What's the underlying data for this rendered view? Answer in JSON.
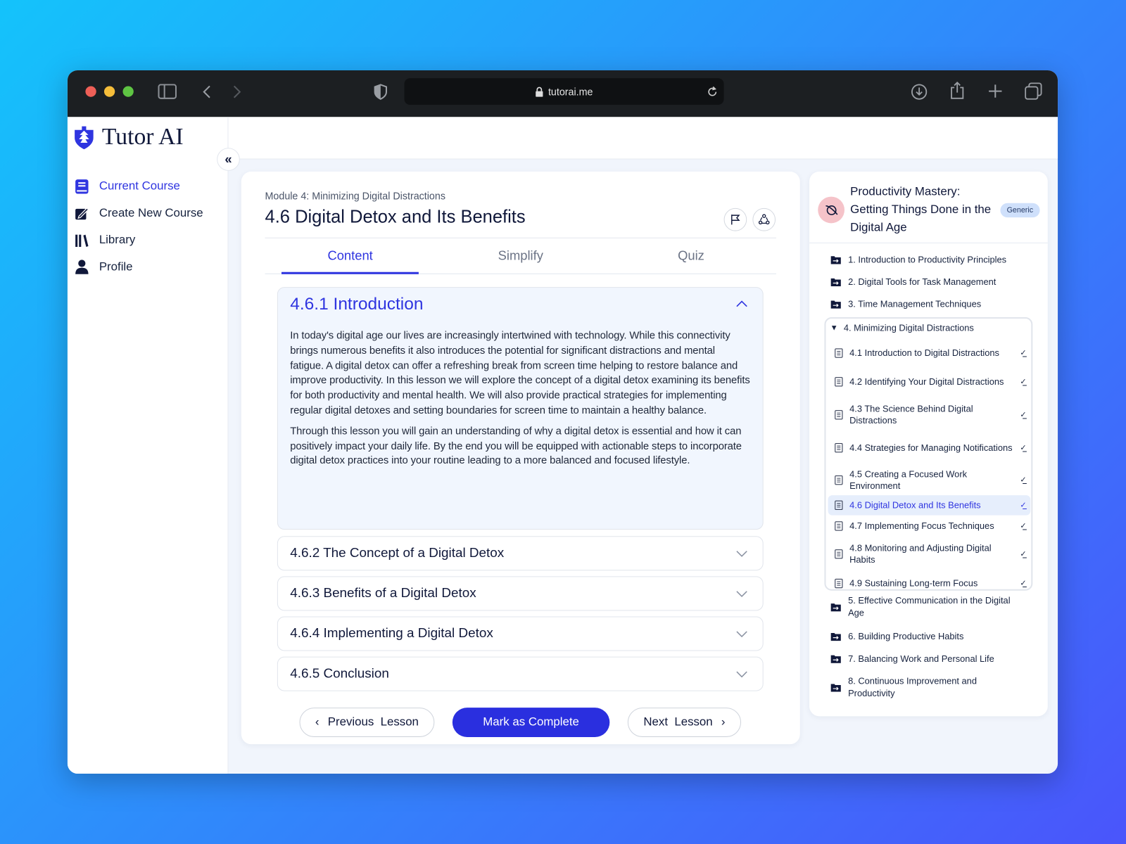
{
  "browser": {
    "url": "tutorai.me"
  },
  "app": {
    "name": "Tutor AI"
  },
  "sidebar": {
    "items": [
      {
        "label": "Current Course",
        "icon": "book-icon",
        "active": true
      },
      {
        "label": "Create New Course",
        "icon": "edit-icon"
      },
      {
        "label": "Library",
        "icon": "library-icon"
      },
      {
        "label": "Profile",
        "icon": "user-icon"
      }
    ]
  },
  "lesson": {
    "module": "Module 4: Minimizing Digital Distractions",
    "title": "4.6 Digital Detox and Its Benefits",
    "tabs": [
      "Content",
      "Simplify",
      "Quiz"
    ],
    "sections": [
      {
        "title": "4.6.1 Introduction",
        "paragraphs": [
          "In today's digital age our lives are increasingly intertwined with technology. While this connectivity brings numerous benefits it also introduces the potential for significant distractions and mental fatigue. A digital detox can offer a refreshing break from screen time helping to restore balance and improve productivity. In this lesson we will explore the concept of a digital detox examining its benefits for both productivity and mental health. We will also provide practical strategies for implementing regular digital detoxes and setting boundaries for screen time to maintain a healthy balance.",
          "Through this lesson you will gain an understanding of why a digital detox is essential and how it can positively impact your daily life. By the end you will be equipped with actionable steps to incorporate digital detox practices into your routine leading to a more balanced and focused lifestyle."
        ]
      },
      {
        "title": "4.6.2 The Concept of a Digital Detox"
      },
      {
        "title": "4.6.3 Benefits of a Digital Detox"
      },
      {
        "title": "4.6.4 Implementing a Digital Detox"
      },
      {
        "title": "4.6.5 Conclusion"
      }
    ],
    "prev_label": "Previous  Lesson",
    "complete_label": "Mark as Complete",
    "next_label": "Next  Lesson"
  },
  "course": {
    "title": "Productivity Mastery: Getting Things Done in the Digital Age",
    "badge": "Generic",
    "modules": [
      "1. Introduction to Productivity Principles",
      "2. Digital Tools for Task Management",
      "3. Time Management Techniques",
      "4. Minimizing Digital Distractions",
      "5. Effective Communication in the Digital Age",
      "6. Building Productive Habits",
      "7. Balancing Work and Personal Life",
      "8. Continuous Improvement and Productivity"
    ],
    "lessons": [
      "4.1 Introduction to Digital Distractions",
      "4.2 Identifying Your Digital Distractions",
      "4.3 The Science Behind Digital Distractions",
      "4.4 Strategies for Managing Notifications",
      "4.5 Creating a Focused Work Environment",
      "4.6 Digital Detox and Its Benefits",
      "4.7 Implementing Focus Techniques",
      "4.8 Monitoring and Adjusting Digital Habits",
      "4.9 Sustaining Long-term Focus"
    ]
  },
  "colors": {
    "accent": "#2f35e0",
    "button": "#2a2fdf"
  }
}
